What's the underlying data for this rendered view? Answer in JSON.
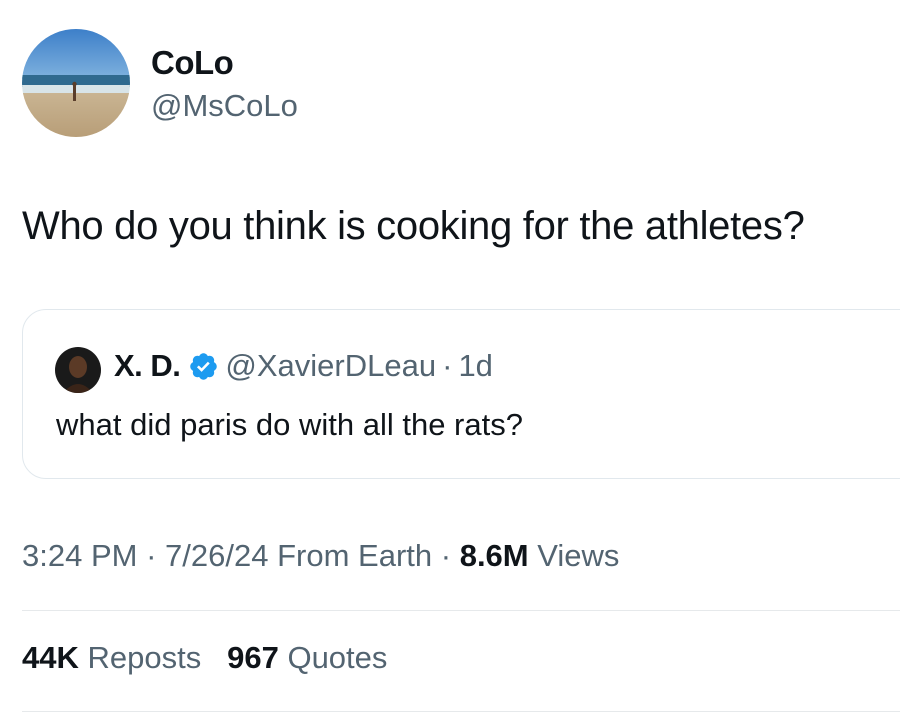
{
  "author": {
    "name": "CoLo",
    "handle": "@MsCoLo"
  },
  "tweet": {
    "text": "Who do you think is cooking for the athletes?"
  },
  "quoted": {
    "name": "X. D.",
    "handle": "@XavierDLeau",
    "separator": "·",
    "time_ago": "1d",
    "text": "what did paris do with all the rats?",
    "verified_icon": "verified-badge-icon"
  },
  "meta": {
    "time": "3:24 PM",
    "separator": "·",
    "date": "7/26/24",
    "source": "From Earth",
    "views_count": "8.6M",
    "views_label": "Views"
  },
  "stats": {
    "reposts_count": "44K",
    "reposts_label": "Reposts",
    "quotes_count": "967",
    "quotes_label": "Quotes"
  },
  "colors": {
    "text": "#0f1419",
    "secondary": "#536471",
    "verified": "#1d9bf0",
    "border": "#e1e8ed"
  }
}
